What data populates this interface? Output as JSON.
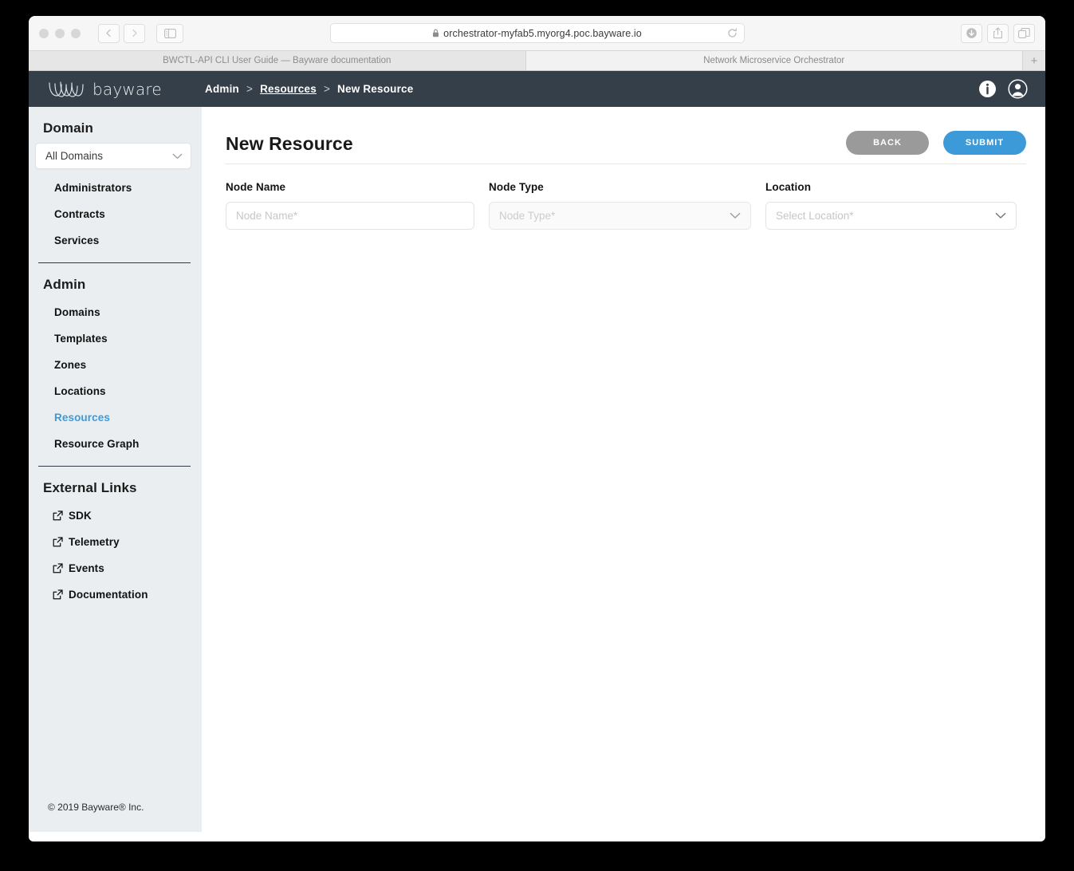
{
  "browser": {
    "url": "orchestrator-myfab5.myorg4.poc.bayware.io",
    "lock_icon": "lock-icon",
    "reload_icon": "reload-icon",
    "back_icon": "chevron-left-icon",
    "forward_icon": "chevron-right-icon",
    "sidebar_icon": "sidebar-toggle-icon",
    "download_icon": "download-icon",
    "share_icon": "share-icon",
    "tabs_overview_icon": "tabs-overview-icon",
    "new_tab_label": "+",
    "tabs": [
      {
        "title": "BWCTL-API CLI User Guide — Bayware documentation",
        "active": false
      },
      {
        "title": "Network Microservice Orchestrator",
        "active": true
      }
    ]
  },
  "header": {
    "logo_text": "bayware",
    "logo_icon": "bayware-wave-logo",
    "breadcrumb": [
      {
        "label": "Admin",
        "link": false
      },
      {
        "label": ">",
        "sep": true
      },
      {
        "label": "Resources",
        "link": true
      },
      {
        "label": ">",
        "sep": true
      },
      {
        "label": "New Resource",
        "link": false
      }
    ],
    "info_icon": "info-icon",
    "account_icon": "user-account-icon"
  },
  "sidebar": {
    "sections": [
      {
        "title": "Domain",
        "select": {
          "value": "All Domains",
          "chevron_icon": "chevron-down-icon"
        },
        "items": [
          {
            "label": "Administrators",
            "active": false,
            "external": false
          },
          {
            "label": "Contracts",
            "active": false,
            "external": false
          },
          {
            "label": "Services",
            "active": false,
            "external": false
          }
        ]
      },
      {
        "title": "Admin",
        "items": [
          {
            "label": "Domains",
            "active": false,
            "external": false
          },
          {
            "label": "Templates",
            "active": false,
            "external": false
          },
          {
            "label": "Zones",
            "active": false,
            "external": false
          },
          {
            "label": "Locations",
            "active": false,
            "external": false
          },
          {
            "label": "Resources",
            "active": true,
            "external": false
          },
          {
            "label": "Resource Graph",
            "active": false,
            "external": false
          }
        ]
      },
      {
        "title": "External Links",
        "items": [
          {
            "label": "SDK",
            "active": false,
            "external": true,
            "icon": "external-link-icon"
          },
          {
            "label": "Telemetry",
            "active": false,
            "external": true,
            "icon": "external-link-icon"
          },
          {
            "label": "Events",
            "active": false,
            "external": true,
            "icon": "external-link-icon"
          },
          {
            "label": "Documentation",
            "active": false,
            "external": true,
            "icon": "external-link-icon"
          }
        ]
      }
    ],
    "footer": "© 2019 Bayware® Inc."
  },
  "main": {
    "title": "New Resource",
    "buttons": {
      "back_label": "BACK",
      "submit_label": "SUBMIT"
    },
    "fields": [
      {
        "label": "Node Name",
        "value": "",
        "placeholder": "Node Name*",
        "type": "text",
        "disabled": false
      },
      {
        "label": "Node Type",
        "value": "",
        "placeholder": "Node Type*",
        "type": "select",
        "disabled": true,
        "chevron_icon": "chevron-down-icon"
      },
      {
        "label": "Location",
        "value": "",
        "placeholder": "Select Location*",
        "type": "select",
        "disabled": false,
        "chevron_icon": "chevron-down-icon"
      }
    ]
  },
  "colors": {
    "header_bg": "#343f49",
    "sidebar_bg": "#ebeef0",
    "accent_blue": "#3d9ad9",
    "back_gray": "#9a9a9a",
    "active_link": "#3d9ad9"
  }
}
